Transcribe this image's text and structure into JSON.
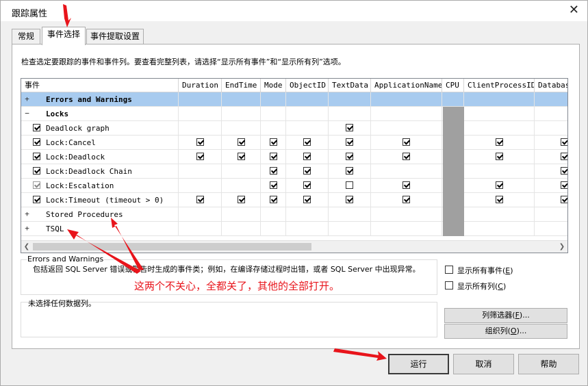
{
  "window": {
    "title": "跟踪属性",
    "close_icon": "close-icon"
  },
  "tabs": [
    {
      "label": "常规"
    },
    {
      "label": "事件选择",
      "active": true
    },
    {
      "label": "事件提取设置"
    }
  ],
  "description": "检查选定要跟踪的事件和事件列。要查看完整列表，请选择“显示所有事件”和“显示所有列”选项。",
  "grid": {
    "event_header": "事件",
    "columns": [
      "Duration",
      "EndTime",
      "Mode",
      "ObjectID",
      "TextData",
      "ApplicationName",
      "CPU",
      "ClientProcessID",
      "Databas"
    ],
    "rows": [
      {
        "name": "Errors and Warnings",
        "type": "category",
        "expander": "+",
        "bold": true,
        "selected": true
      },
      {
        "name": "Locks",
        "type": "category",
        "expander": "−",
        "bold": true
      },
      {
        "name": "Deadlock graph",
        "type": "event",
        "checked": true,
        "cells": [
          0,
          0,
          0,
          0,
          1,
          0,
          0,
          0,
          0
        ]
      },
      {
        "name": "Lock:Cancel",
        "type": "event",
        "checked": true,
        "cells": [
          1,
          1,
          1,
          1,
          1,
          1,
          0,
          1,
          1
        ]
      },
      {
        "name": "Lock:Deadlock",
        "type": "event",
        "checked": true,
        "cells": [
          1,
          1,
          1,
          1,
          1,
          1,
          0,
          1,
          1
        ]
      },
      {
        "name": "Lock:Deadlock Chain",
        "type": "event",
        "checked": true,
        "cells": [
          0,
          0,
          1,
          1,
          1,
          0,
          0,
          0,
          1
        ]
      },
      {
        "name": "Lock:Escalation",
        "type": "event",
        "checked": true,
        "gray": true,
        "cells": [
          0,
          0,
          1,
          1,
          2,
          1,
          0,
          1,
          1
        ]
      },
      {
        "name": "Lock:Timeout (timeout > 0)",
        "type": "event",
        "checked": true,
        "cells": [
          1,
          1,
          1,
          1,
          1,
          1,
          0,
          1,
          1
        ]
      },
      {
        "name": "Stored Procedures",
        "type": "category",
        "expander": "+"
      },
      {
        "name": "TSQL",
        "type": "category",
        "expander": "+"
      }
    ]
  },
  "event_description": {
    "title": "Errors and Warnings",
    "text": "包括返回 SQL Server 错误或警告时生成的事件类；例如，在编译存储过程时出错，或者 SQL Server 中出现异常。"
  },
  "column_info": {
    "text": "未选择任何数据列。"
  },
  "options": {
    "show_all_events": {
      "label": "显示所有事件(",
      "key": "E",
      "suffix": ")",
      "checked": false
    },
    "show_all_columns": {
      "label": "显示所有列(",
      "key": "C",
      "suffix": ")",
      "checked": false
    }
  },
  "buttons": {
    "column_filter": {
      "label": "列筛选器(",
      "key": "F",
      "suffix": ")..."
    },
    "organize_columns": {
      "label": "组织列(",
      "key": "O",
      "suffix": ")..."
    },
    "run": "运行",
    "cancel": "取消",
    "help": "帮助"
  },
  "annotation": "这两个不关心，全都关了，其他的全部打开。",
  "annotation_color": "#e8141b",
  "selection_color": "#a8cbef"
}
